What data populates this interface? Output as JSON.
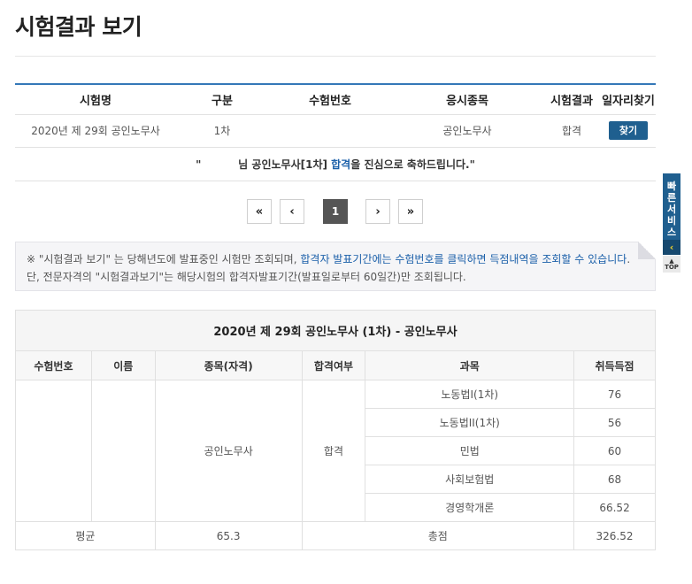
{
  "page_title": "시험결과 보기",
  "result_table": {
    "headers": [
      "시험명",
      "구분",
      "수험번호",
      "응시종목",
      "시험결과",
      "일자리찾기"
    ],
    "row": {
      "exam_name": "2020년 제 29회 공인노무사",
      "round": "1차",
      "exam_number": "",
      "field": "공인노무사",
      "result": "합격",
      "find_label": "찾기"
    },
    "congrats": {
      "prefix": "\"          님 공인노무사[1차] ",
      "pass_word": "합격",
      "suffix": "을 진심으로 축하드립니다.\""
    }
  },
  "pagination": {
    "first": "«",
    "prev": "‹",
    "current": "1",
    "next": "›",
    "last": "»"
  },
  "notice": {
    "part1": "※ \"시험결과 보기\" 는 당해년도에 발표중인 시험만 조회되며, ",
    "highlight": "합격자 발표기간에는 수험번호를 클릭하면 득점내역을 조회할 수 있습니다",
    "part2": ". 단, 전문자격의 \"시험결과보기\"는 해당시험의 합격자발표기간(발표일로부터 60일간)만 조회됩니다."
  },
  "detail": {
    "caption": "2020년 제 29회 공인노무사 (1차) - 공인노무사",
    "headers": [
      "수험번호",
      "이름",
      "종목(자격)",
      "합격여부",
      "과목",
      "취득득점"
    ],
    "exam_number": "",
    "name": "",
    "qualification": "공인노무사",
    "pass_status": "합격",
    "subjects": [
      {
        "name": "노동법I(1차)",
        "score": "76"
      },
      {
        "name": "노동법II(1차)",
        "score": "56"
      },
      {
        "name": "민법",
        "score": "60"
      },
      {
        "name": "사회보험법",
        "score": "68"
      },
      {
        "name": "경영학개론",
        "score": "66.52"
      }
    ],
    "average_label": "평균",
    "average_value": "65.3",
    "total_label": "총점",
    "total_value": "326.52"
  },
  "quick_service": {
    "label": "빠른서비스",
    "top_label": "TOP"
  },
  "colors": {
    "accent": "#3478b8",
    "button": "#1f5f8f",
    "highlight": "#1a5fa9"
  }
}
